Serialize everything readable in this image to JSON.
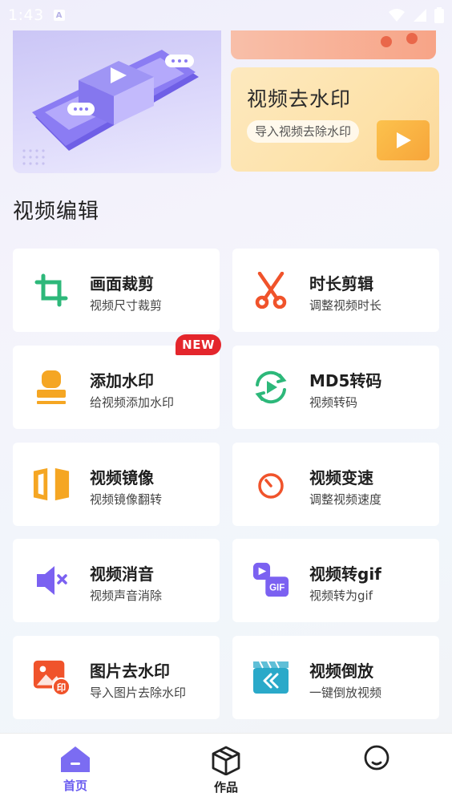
{
  "status_bar": {
    "time": "1:43",
    "badge": "A"
  },
  "banners": {
    "watermark": {
      "title": "视频去水印",
      "subtitle": "导入视频去除水印"
    }
  },
  "section": {
    "title": "视频编辑"
  },
  "tools": [
    {
      "title": "画面裁剪",
      "subtitle": "视频尺寸裁剪",
      "icon": "crop-icon",
      "color": "#2db87a"
    },
    {
      "title": "时长剪辑",
      "subtitle": "调整视频时长",
      "icon": "scissors-icon",
      "color": "#f0532b"
    },
    {
      "title": "添加水印",
      "subtitle": "给视频添加水印",
      "icon": "stamp-icon",
      "color": "#f5a623",
      "badge": "NEW"
    },
    {
      "title": "MD5转码",
      "subtitle": "视频转码",
      "icon": "transcode-icon",
      "color": "#2db87a"
    },
    {
      "title": "视频镜像",
      "subtitle": "视频镜像翻转",
      "icon": "mirror-icon",
      "color": "#f5a623"
    },
    {
      "title": "视频变速",
      "subtitle": "调整视频速度",
      "icon": "speed-icon",
      "color": "#f0532b"
    },
    {
      "title": "视频消音",
      "subtitle": "视频声音消除",
      "icon": "mute-icon",
      "color": "#7b61f1"
    },
    {
      "title": "视频转gif",
      "subtitle": "视频转为gif",
      "icon": "gif-icon",
      "color": "#7b61f1"
    },
    {
      "title": "图片去水印",
      "subtitle": "导入图片去除水印",
      "icon": "image-watermark-icon",
      "color": "#f0532b"
    },
    {
      "title": "视频倒放",
      "subtitle": "一键倒放视频",
      "icon": "rewind-icon",
      "color": "#2aa9c9"
    }
  ],
  "nav": [
    {
      "label": "首页",
      "icon": "home-icon",
      "active": true,
      "color": "#6a5cf0"
    },
    {
      "label": "作品",
      "icon": "box-icon",
      "active": false,
      "color": "#222222"
    },
    {
      "label": "",
      "icon": "profile-icon",
      "active": false,
      "color": "#222222"
    }
  ]
}
